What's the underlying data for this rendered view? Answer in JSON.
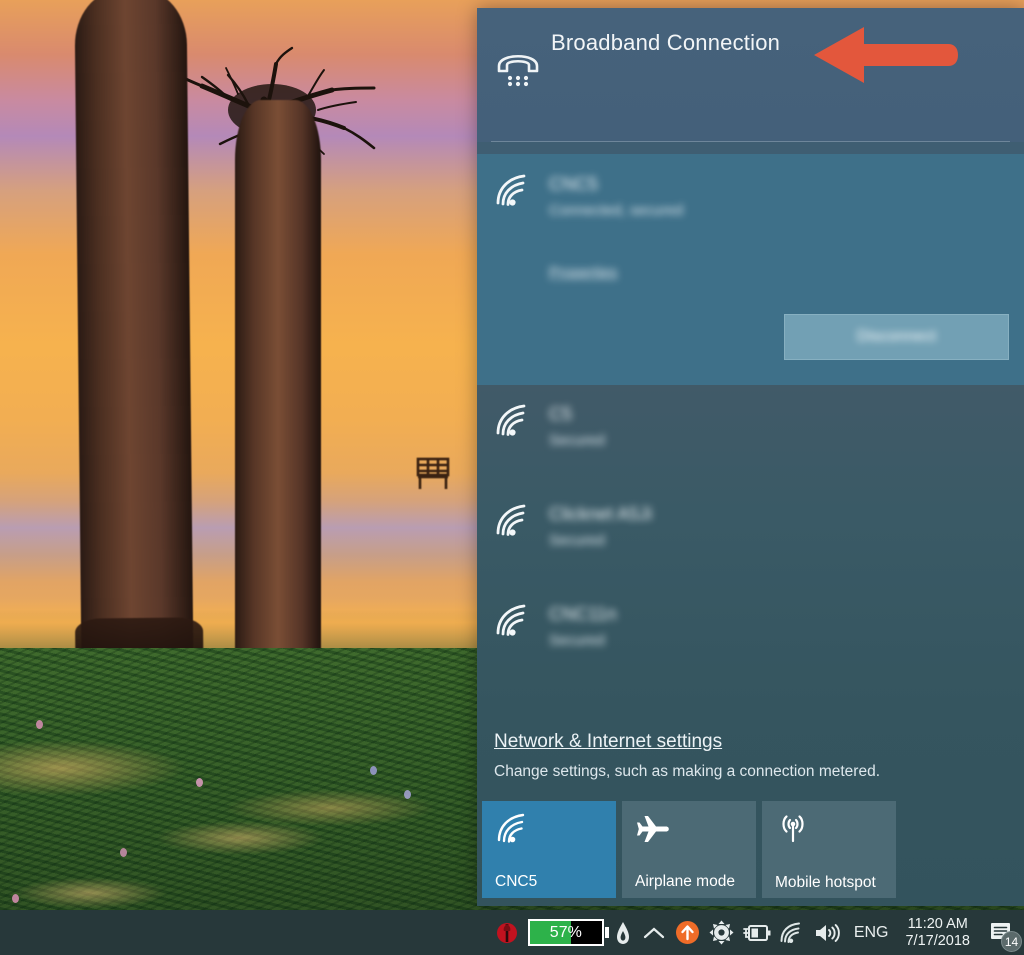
{
  "wallpaper": {
    "name": "baobab-sunset-wallpaper",
    "description": "Baobab trees silhouetted against an orange and purple sunset above a green flooded meadow"
  },
  "flyout": {
    "broadband": {
      "icon": "dialup-phone-icon",
      "label": "Broadband Connection"
    },
    "connected_network": {
      "icon": "wifi-icon",
      "name": "CNC5",
      "status": "Connected, secured",
      "properties_label": "Properties",
      "disconnect_label": "Disconnect",
      "obscured": true
    },
    "available_networks": [
      {
        "icon": "wifi-icon",
        "name": "C5",
        "status": "Secured",
        "obscured": true
      },
      {
        "icon": "wifi-icon",
        "name": "Clicknet A5Ji",
        "status": "Secured",
        "obscured": true
      },
      {
        "icon": "wifi-icon",
        "name": "CNC11n",
        "status": "Secured",
        "obscured": true
      }
    ],
    "settings": {
      "link_label": "Network & Internet settings",
      "description": "Change settings, such as making a connection metered."
    },
    "quick_tiles": [
      {
        "icon": "wifi-icon",
        "label": "CNC5",
        "active": true
      },
      {
        "icon": "airplane-icon",
        "label": "Airplane mode",
        "active": false
      },
      {
        "icon": "hotspot-icon",
        "label": "Mobile hotspot",
        "active": false
      }
    ]
  },
  "annotation": {
    "arrow": {
      "name": "red-pointer-arrow",
      "direction": "left",
      "color": "#e3573c",
      "points_at": "Broadband Connection"
    }
  },
  "taskbar": {
    "tray_icons": [
      {
        "name": "ladybug-icon"
      },
      {
        "name": "battery-percent-indicator"
      },
      {
        "name": "flame-icon"
      },
      {
        "name": "show-hidden-icons-chevron"
      },
      {
        "name": "update-arrow-icon"
      },
      {
        "name": "gear-icon"
      },
      {
        "name": "battery-plug-icon"
      },
      {
        "name": "wifi-icon"
      },
      {
        "name": "volume-icon"
      }
    ],
    "battery": {
      "percent_label": "57%",
      "percent_value": 57,
      "fill_color": "#2db24a"
    },
    "language": "ENG",
    "clock": {
      "time": "11:20 AM",
      "date": "7/17/2018"
    },
    "action_center": {
      "name": "action-center-icon",
      "badge_count": "14"
    }
  },
  "colors": {
    "panel_top": "#46627b",
    "panel_connected": "#3e7089",
    "panel_list": "#3a5a66",
    "tile_active": "#3080ad",
    "tile_inactive": "#4c6a75",
    "taskbar": "#27383a",
    "arrow_red": "#e3573c",
    "battery_green": "#2db24a"
  }
}
